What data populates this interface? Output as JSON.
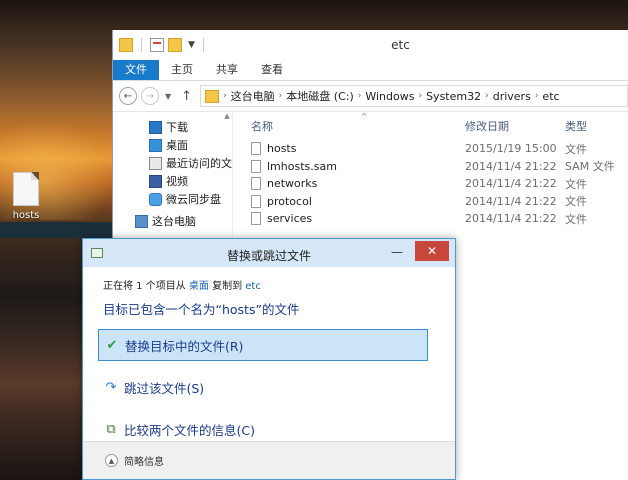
{
  "desktop": {
    "icon_label": "hosts"
  },
  "explorer": {
    "title": "etc",
    "tabs": [
      "文件",
      "主页",
      "共享",
      "查看"
    ],
    "address": [
      "这台电脑",
      "本地磁盘 (C:)",
      "Windows",
      "System32",
      "drivers",
      "etc"
    ],
    "nav_items": [
      {
        "label": "下载",
        "icon": "download-icon"
      },
      {
        "label": "桌面",
        "icon": "desktop-icon"
      },
      {
        "label": "最近访问的文",
        "icon": "recent-icon"
      },
      {
        "label": "视频",
        "icon": "video-icon"
      },
      {
        "label": "微云同步盘",
        "icon": "cloud-icon"
      },
      {
        "label": "这台电脑",
        "icon": "computer-icon"
      }
    ],
    "columns": {
      "name": "名称",
      "date": "修改日期",
      "type": "类型"
    },
    "files": [
      {
        "name": "hosts",
        "date": "2015/1/19 15:00",
        "type": "文件"
      },
      {
        "name": "lmhosts.sam",
        "date": "2014/11/4 21:22",
        "type": "SAM 文件"
      },
      {
        "name": "networks",
        "date": "2014/11/4 21:22",
        "type": "文件"
      },
      {
        "name": "protocol",
        "date": "2014/11/4 21:22",
        "type": "文件"
      },
      {
        "name": "services",
        "date": "2014/11/4 21:22",
        "type": "文件"
      }
    ]
  },
  "dialog": {
    "title": "替换或跳过文件",
    "min_glyph": "—",
    "close_glyph": "✕",
    "line1_prefix": "正在将 1 个项目从 ",
    "line1_src": "桌面",
    "line1_mid": " 复制到 ",
    "line1_dst": "etc",
    "heading": "目标已包含一个名为“hosts”的文件",
    "options": [
      {
        "label": "替换目标中的文件(R)",
        "icon": "check-icon"
      },
      {
        "label": "跳过该文件(S)",
        "icon": "skip-icon"
      },
      {
        "label": "比较两个文件的信息(C)",
        "icon": "compare-icon"
      }
    ],
    "footer": "简略信息"
  }
}
